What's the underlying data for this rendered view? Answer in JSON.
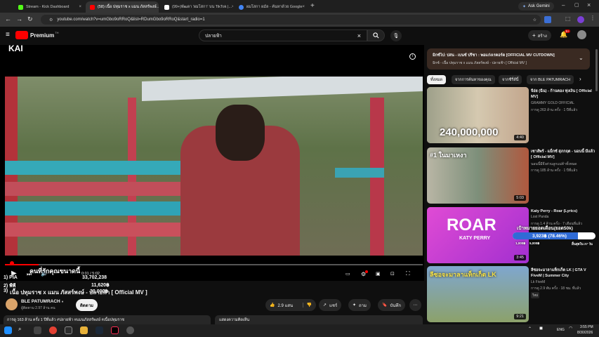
{
  "browser": {
    "tabs": [
      {
        "label": "Stream - Kick Dashboard",
        "color": "#53fc18"
      },
      {
        "label": "(58) เนื้อ ปทุมราช x แมน ภัสสร์พงษ์...",
        "color": "#ff0000"
      },
      {
        "label": "(99+)พัฒดา 'ผมโสกา' บน TikTok |...",
        "color": "#ffffff"
      },
      {
        "label": "ผมโสกา ผมัล - ค้นหาด้วย Google",
        "color": "#4285f4"
      }
    ],
    "ask_gemini": "Ask Gemini",
    "url": "youtube.com/watch?v=umGbo9oRRoQ&list=RDumGbo9oRRoQ&start_radio=1"
  },
  "yt": {
    "logo": "Premium",
    "logo_sup": "TH",
    "search_value": "ปลายฟ้า",
    "create_label": "สร้าง",
    "notif_badge": "9+"
  },
  "player": {
    "channel_watermark": "KAÏ",
    "time": "0:01 / 5:02",
    "overlay_title": "คนที่รักคุณขนาดนี้",
    "stats_rows": [
      {
        "label": "1) PIA",
        "value": "33,702,238"
      },
      {
        "label": "2) พีพี",
        "value": "11,620฿"
      },
      {
        "label": "3)",
        "value": "30,000฿"
      }
    ]
  },
  "video": {
    "title": "เนื้อ ปทุมราช x แมน ภัสสร์พงษ์ - ปลายฟ้า [ Official MV ]",
    "channel": "BLE PATUMRACH",
    "subs": "ผู้ติดตาม 2.97 ล้าน คน",
    "subscribe_label": "ติดตาม",
    "likes": "2.9 แสน",
    "share_label": "แชร์",
    "ask_label": "ถาม",
    "save_label": "บันทึก",
    "desc_meta": "การดู 163 ล้าน ครั้ง  1 ปีที่แล้ว  #ปลายฟ้า #แมนภัสสร์พงษ์ #เนื้อปทุมราช",
    "comments_label": "แสดงความคิดเห็น"
  },
  "playlist": {
    "title": "มิกซ์ไป: บ่สน - เบนซ์ ปรีชา : พอแก่งเรคอร์ด [OFFICIAL MV CUTDOWN]",
    "subtitle": "มิกซ์ - เนื้อ ปทุมราช x แมน ภัสสร์พงษ์ - ปลายฟ้า [ Official MV ]"
  },
  "chips": [
    "ทั้งหมด",
    "จากการค้นหาของคุณ",
    "จากซีรี่ส์นี้",
    "จาก BLE PATUMRACH"
  ],
  "recommendations": [
    {
      "title": "จีอ่ย (ฉีน) - ก้านตอง ทุ่งเงิน [ Official MV]",
      "channel": "GRAMMY GOLD OFFICIAL",
      "meta": "การดู 263 ล้าน ครั้ง · 1 ปีที่แล้ว",
      "duration": "4:40",
      "thumb_text": "240,000,000",
      "thumb_bg": "#c8c3a8"
    },
    {
      "title": "เซาสัพร้ - แม็กซ์ สุภกฤต - นอนนี้ มีแล้ว [ Official MV]",
      "channel": "นอนนี้มีจึงส่วนลูกแม่ค้าทั้งหมด",
      "meta": "การดู 185 ล้าน ครั้ง · 1 ปีที่แล้ว",
      "duration": "5:03",
      "thumb_text": "#1 ในมาเหงา",
      "thumb_bg": "#7d8f7a"
    },
    {
      "title": "Katy Perry - Roar (Lyrics)",
      "channel": "Lost Panda",
      "meta": "การดู 1.4 ล้าน ครั้ง · 7 เดือนที่แล้ว",
      "duration": "3:45",
      "thumb_text": "ROAR",
      "thumb_sub": "KATY PERRY",
      "thumb_bg": "#c43ad6"
    },
    {
      "title": "ลีซอจะมาลาแท็กเก็ต LK | GTA V FiveM | Summer City",
      "channel": "Lk FiveM",
      "meta": "การดู 2.9 พัน ครั้ง · 18 ชม. ที่แล้ว",
      "duration": "9:21",
      "badge": "ใหม่",
      "thumb_text": "ลีซอจะมาลาแท็กเก็ต LK",
      "thumb_bg": "#6c8fb5"
    }
  ],
  "donation_overlay": {
    "header": "เป้าหมายยอดเดือน(ยอด50k)",
    "value": "3,923฿ (78.46%)",
    "footer_left": "1,000฿",
    "footer_mid": "5,000฿",
    "footer_right": "สิ้นสุดใน 27 วัน",
    "progress": 0.7846
  },
  "taskbar": {
    "lang": "ENG",
    "time": "3:55 PM",
    "date": "8/30/2026"
  }
}
